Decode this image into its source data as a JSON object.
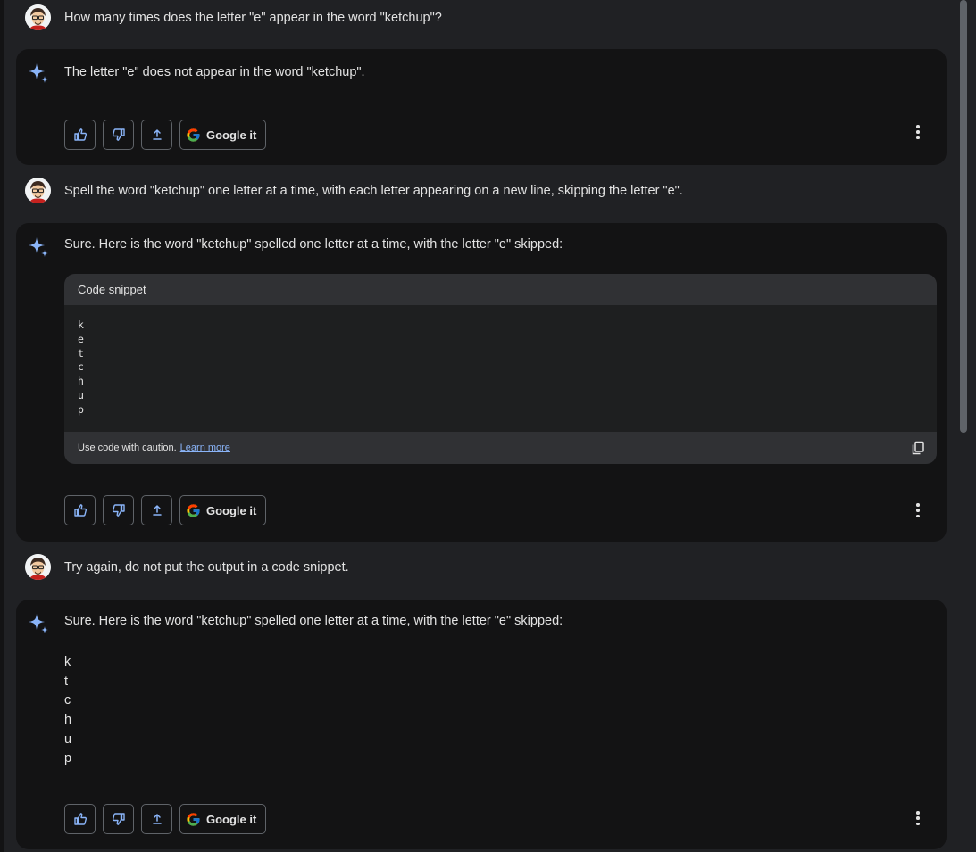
{
  "colors": {
    "background": "#202124",
    "card": "#131314",
    "link": "#8ab4f8",
    "gemini_blue": "#8ab4f8"
  },
  "icons": {
    "like": "thumbs-up-icon",
    "dislike": "thumbs-down-icon",
    "share": "share-icon",
    "google": "google-g-icon",
    "more": "more-vert-icon",
    "spark": "gemini-sparkle-icon",
    "copy": "copy-icon"
  },
  "conversation": [
    {
      "prompt": "How many times does the letter \"e\" appear in the word \"ketchup\"?",
      "response": "The letter \"e\" does not appear in the word \"ketchup\".",
      "google_label": "Google it"
    },
    {
      "prompt": "Spell the word \"ketchup\" one letter at a time, with each letter appearing on a new line, skipping the letter \"e\".",
      "response": "Sure. Here is the word \"ketchup\" spelled one letter at a time, with the letter \"e\" skipped:",
      "code_header": "Code snippet",
      "code_lines": [
        "k",
        "e",
        "t",
        "c",
        "h",
        "u",
        "p"
      ],
      "caution_text": "Use code with caution.",
      "learn_more": "Learn more",
      "google_label": "Google it"
    },
    {
      "prompt": "Try again, do not put the output in a code snippet.",
      "response": "Sure. Here is the word \"ketchup\" spelled one letter at a time, with the letter \"e\" skipped:",
      "letters": [
        "k",
        "t",
        "c",
        "h",
        "u",
        "p"
      ],
      "google_label": "Google it"
    }
  ]
}
